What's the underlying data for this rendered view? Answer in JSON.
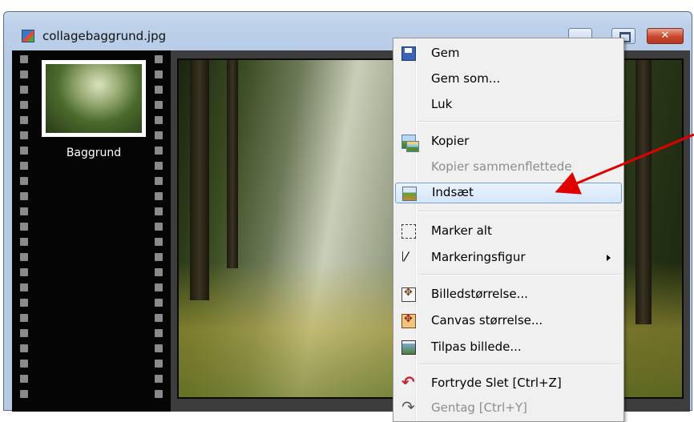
{
  "window": {
    "title": "collagebaggrund.jpg",
    "icon": "image-file-icon",
    "controls": {
      "minimize": "minimize-icon",
      "maximize": "maximize-icon",
      "close_label": "✕"
    }
  },
  "filmstrip": {
    "thumbnail_label": "Baggrund"
  },
  "context_menu": {
    "items": [
      {
        "label": "Gem",
        "icon": "save-icon"
      },
      {
        "label": "Gem som...",
        "icon": ""
      },
      {
        "label": "Luk",
        "icon": ""
      },
      {
        "label": "Kopier",
        "icon": "copy-image-icon"
      },
      {
        "label": "Kopier sammenflettede",
        "icon": "",
        "disabled": true
      },
      {
        "label": "Indsæt",
        "icon": "paste-image-icon",
        "highlighted": true
      },
      {
        "label": "Marker alt",
        "icon": "select-all-icon"
      },
      {
        "label": "Markeringsfigur",
        "icon": "cursor-icon",
        "submenu": true
      },
      {
        "label": "Billedstørrelse...",
        "icon": "image-size-icon"
      },
      {
        "label": "Canvas størrelse...",
        "icon": "canvas-size-icon"
      },
      {
        "label": "Tilpas billede...",
        "icon": "fit-image-icon"
      },
      {
        "label": "Fortryde Slet [Ctrl+Z]",
        "icon": "undo-icon"
      },
      {
        "label": "Gentag [Ctrl+Y]",
        "icon": "redo-icon",
        "disabled": true
      }
    ]
  },
  "annotation": {
    "arrow_color": "#e00000",
    "points_to": "Indsæt"
  },
  "colors": {
    "menu_background": "#f0f0f0",
    "highlight_border": "#7da2ce",
    "filmstrip": "#050505"
  }
}
